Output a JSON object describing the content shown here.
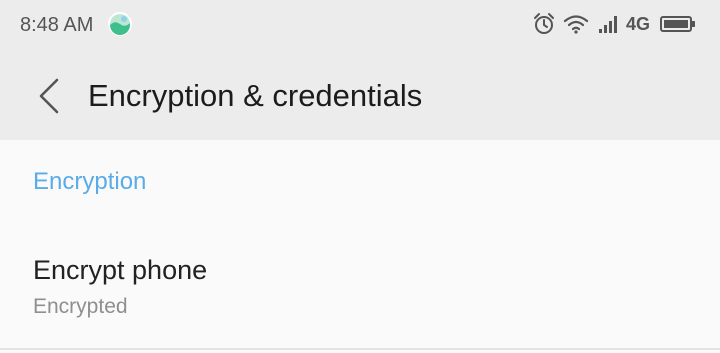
{
  "status_bar": {
    "time": "8:48 AM",
    "app_icon": "weather-app-icon",
    "icons": [
      "alarm-icon",
      "wifi-icon",
      "signal-icon",
      "battery-icon"
    ],
    "network": "4G"
  },
  "app_bar": {
    "back_icon": "chevron-left-icon",
    "title": "Encryption & credentials"
  },
  "content": {
    "section_header": "Encryption",
    "items": [
      {
        "title": "Encrypt phone",
        "subtitle": "Encrypted"
      }
    ]
  },
  "colors": {
    "status_bar_bg": "#ececec",
    "content_bg": "#fafafa",
    "accent": "#5aace8",
    "title_text": "#1c1c1c",
    "subtitle_text": "#8f8f8f"
  }
}
